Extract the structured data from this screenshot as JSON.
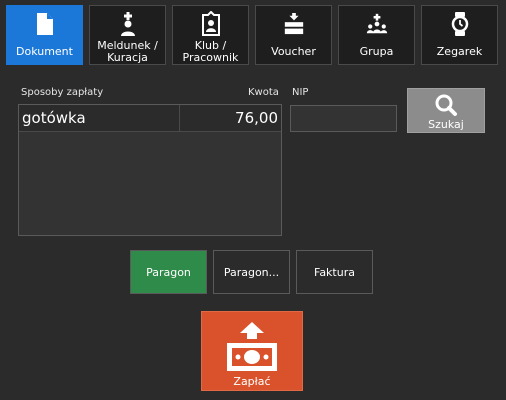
{
  "toolbar": {
    "buttons": [
      {
        "label": "Dokument",
        "icon": "document-icon",
        "active": true
      },
      {
        "label": "Meldunek /\nKuracja",
        "icon": "person-plus-icon",
        "active": false
      },
      {
        "label": "Klub /\nPracownik",
        "icon": "id-badge-icon",
        "active": false
      },
      {
        "label": "Voucher",
        "icon": "voucher-icon",
        "active": false
      },
      {
        "label": "Grupa",
        "icon": "group-icon",
        "active": false
      },
      {
        "label": "Zegarek",
        "icon": "watch-icon",
        "active": false
      }
    ]
  },
  "payments": {
    "header_method": "Sposoby zapłaty",
    "header_amount": "Kwota",
    "rows": [
      {
        "method": "gotówka",
        "amount": "76,00"
      }
    ]
  },
  "nip": {
    "label": "NIP",
    "value": ""
  },
  "search": {
    "label": "Szukaj",
    "icon": "search-icon"
  },
  "document_types": [
    {
      "label": "Paragon",
      "selected": true
    },
    {
      "label": "Paragon...",
      "selected": false
    },
    {
      "label": "Faktura",
      "selected": false
    }
  ],
  "pay": {
    "label": "Zapłać",
    "icon": "cash-payment-icon"
  },
  "colors": {
    "background": "#2b2b2b",
    "active_tab": "#1c78d8",
    "selected_doc": "#2e8b4a",
    "pay_button": "#d9522b",
    "search_button": "#8c8c8c"
  }
}
